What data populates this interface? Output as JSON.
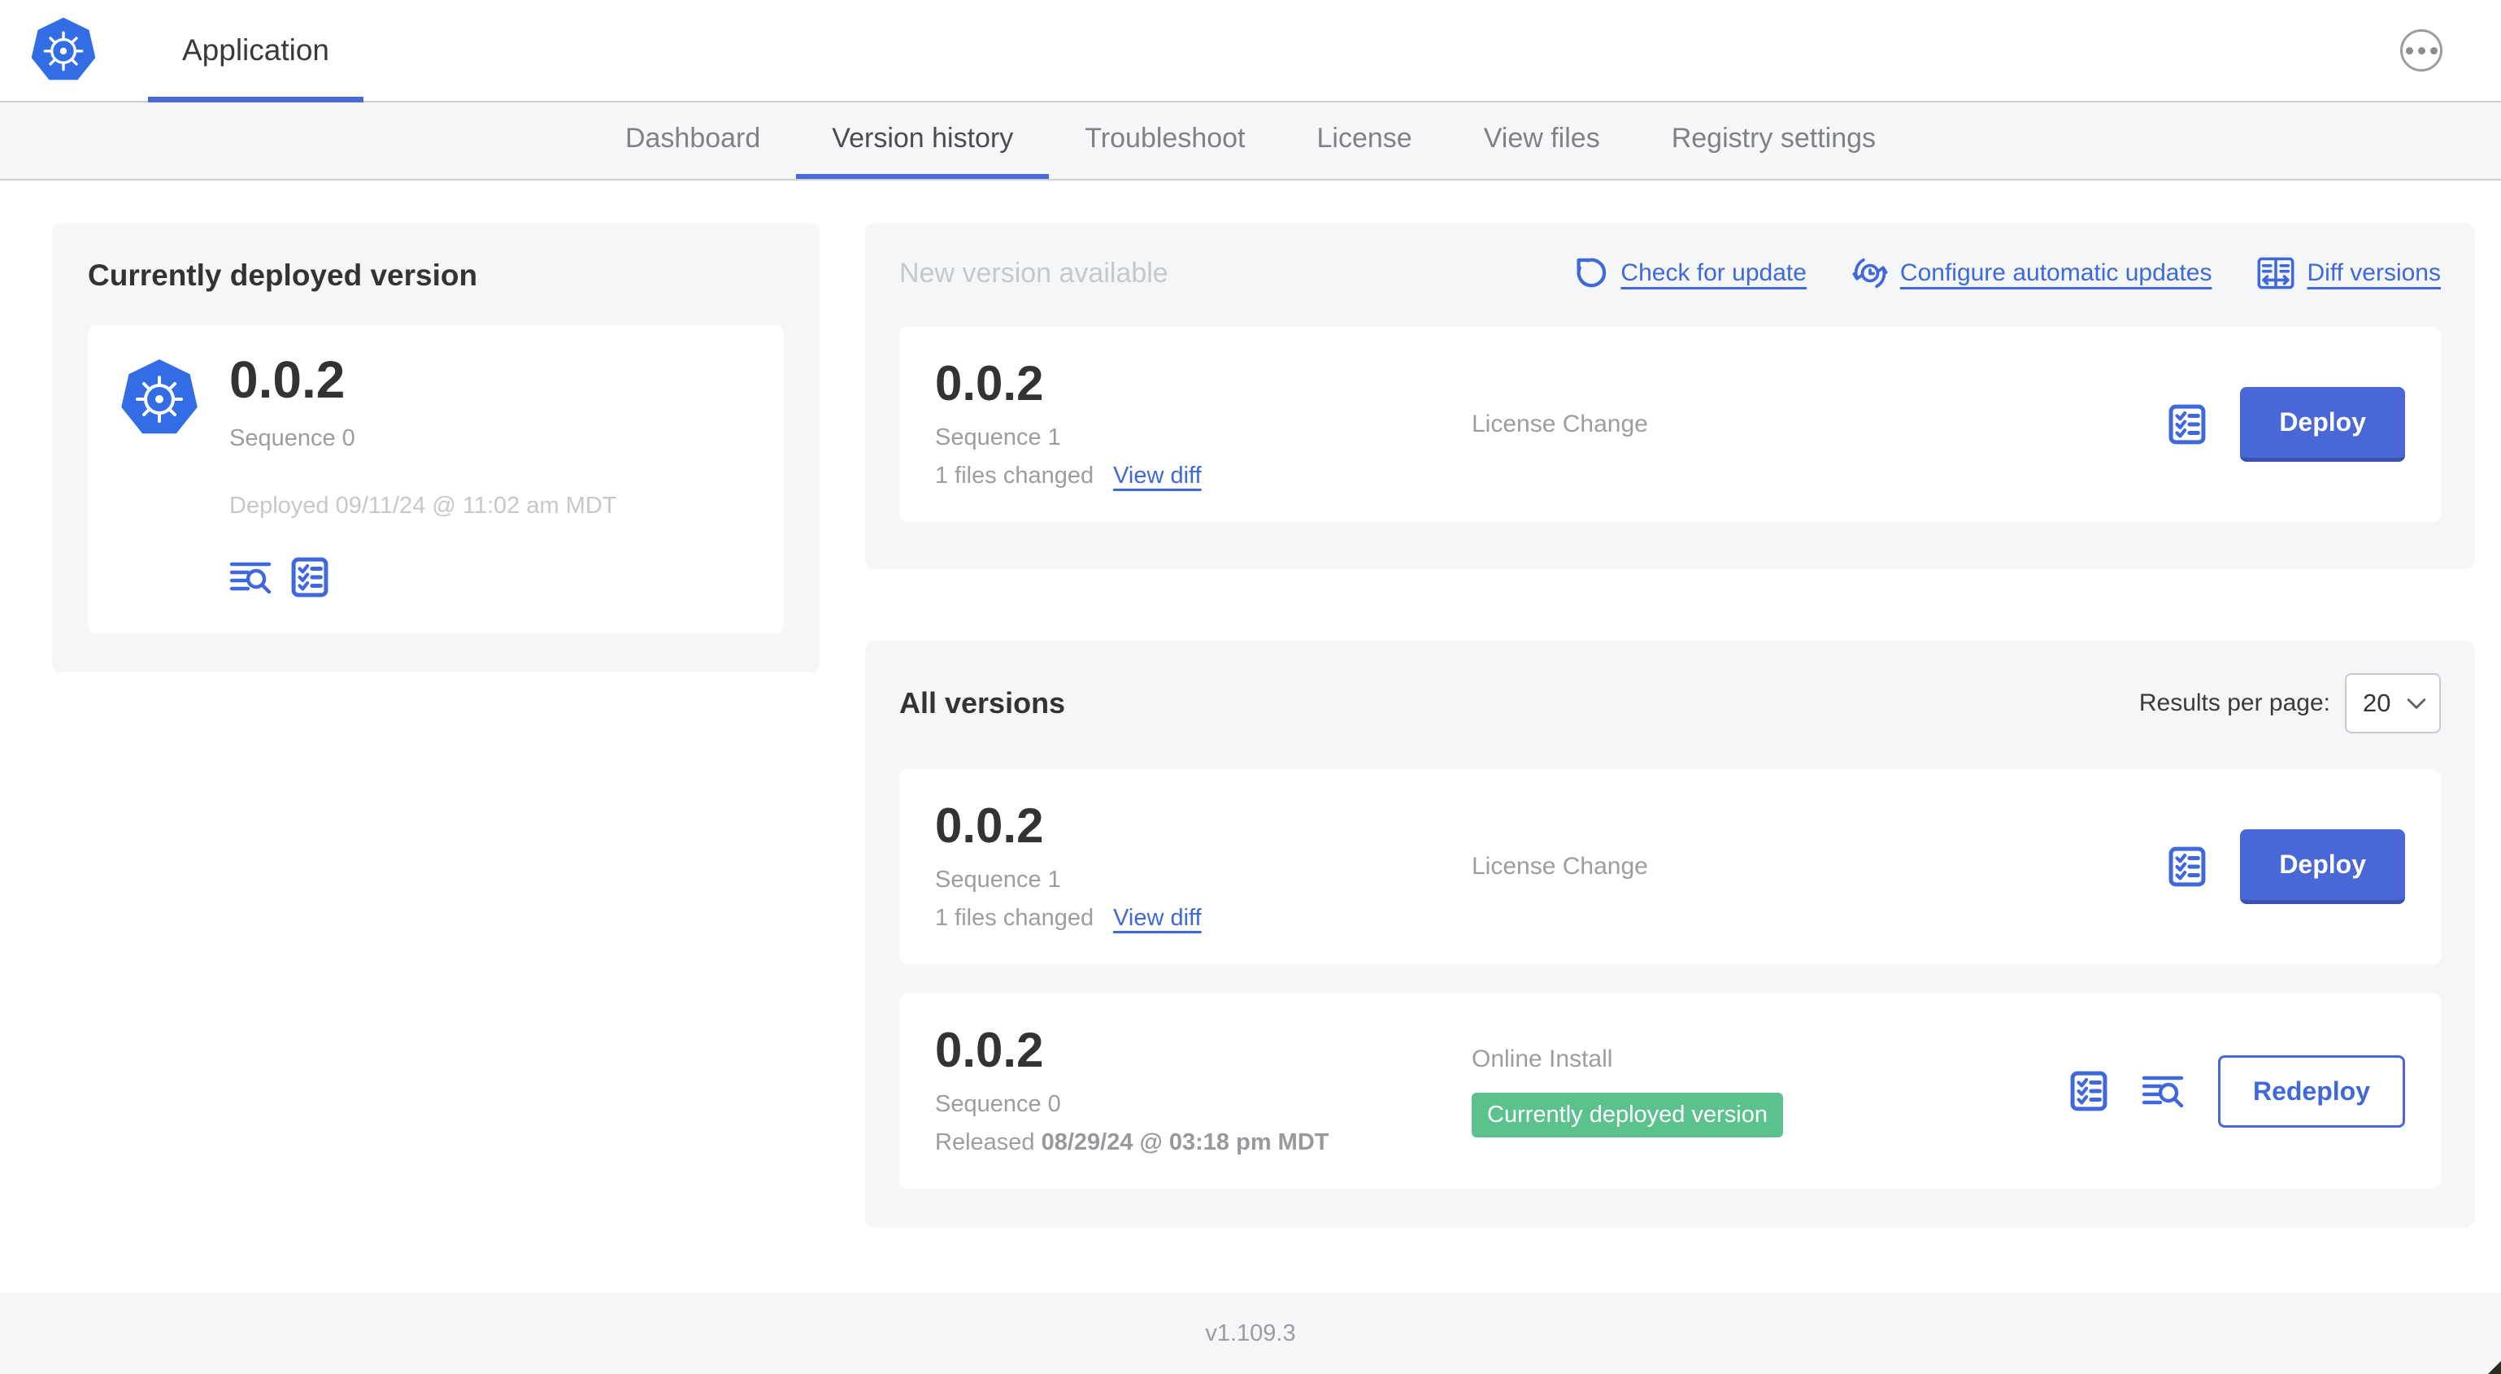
{
  "header": {
    "app_title": "Application"
  },
  "nav": {
    "tabs": [
      {
        "label": "Dashboard",
        "active": false
      },
      {
        "label": "Version history",
        "active": true
      },
      {
        "label": "Troubleshoot",
        "active": false
      },
      {
        "label": "License",
        "active": false
      },
      {
        "label": "View files",
        "active": false
      },
      {
        "label": "Registry settings",
        "active": false
      }
    ]
  },
  "current_version_panel": {
    "title": "Currently deployed version",
    "version": "0.0.2",
    "sequence": "Sequence 0",
    "deployed": "Deployed 09/11/24 @ 11:02 am MDT"
  },
  "new_version_panel": {
    "title": "New version available",
    "actions": [
      {
        "label": "Check for update",
        "icon": "refresh-icon"
      },
      {
        "label": "Configure automatic updates",
        "icon": "schedule-sync-icon"
      },
      {
        "label": "Diff versions",
        "icon": "diff-icon"
      }
    ],
    "card": {
      "version": "0.0.2",
      "sequence": "Sequence 1",
      "files_changed": "1 files changed",
      "view_diff_label": "View diff",
      "source": "License Change",
      "deploy_label": "Deploy"
    }
  },
  "all_versions_panel": {
    "title": "All versions",
    "results_per_page_label": "Results per page:",
    "results_per_page_value": "20",
    "rows": [
      {
        "version": "0.0.2",
        "sequence": "Sequence 1",
        "files_changed": "1 files changed",
        "view_diff_label": "View diff",
        "source": "License Change",
        "action_label": "Deploy"
      },
      {
        "version": "0.0.2",
        "sequence": "Sequence 0",
        "released_prefix": "Released",
        "released_date": "08/29/24 @ 03:18 pm MDT",
        "source": "Online Install",
        "badge": "Currently deployed version",
        "action_label": "Redeploy"
      }
    ]
  },
  "footer": {
    "version": "v1.109.3"
  },
  "colors": {
    "k8s_blue": "#326de6",
    "accent_blue": "#4a67d8",
    "link_blue": "#3f68da",
    "badge_green": "#5bc18d",
    "panel_bg": "#f4f6f8",
    "text_dark": "#333333",
    "text_gray": "#9b9da0",
    "text_light_gray": "#c5c8cc"
  }
}
